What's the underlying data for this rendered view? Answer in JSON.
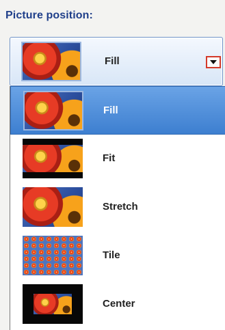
{
  "section": {
    "title": "Picture position:"
  },
  "combo": {
    "selected_label": "Fill",
    "dropdown_open": true
  },
  "options": [
    {
      "label": "Fill",
      "selected": true
    },
    {
      "label": "Fit",
      "selected": false
    },
    {
      "label": "Stretch",
      "selected": false
    },
    {
      "label": "Tile",
      "selected": false
    },
    {
      "label": "Center",
      "selected": false
    }
  ],
  "colors": {
    "title": "#1f3f8a",
    "selection": "#3d7fd0",
    "dropdown_button_border": "#d43a2a"
  },
  "icons": {
    "dropdown": "chevron-down-icon"
  }
}
